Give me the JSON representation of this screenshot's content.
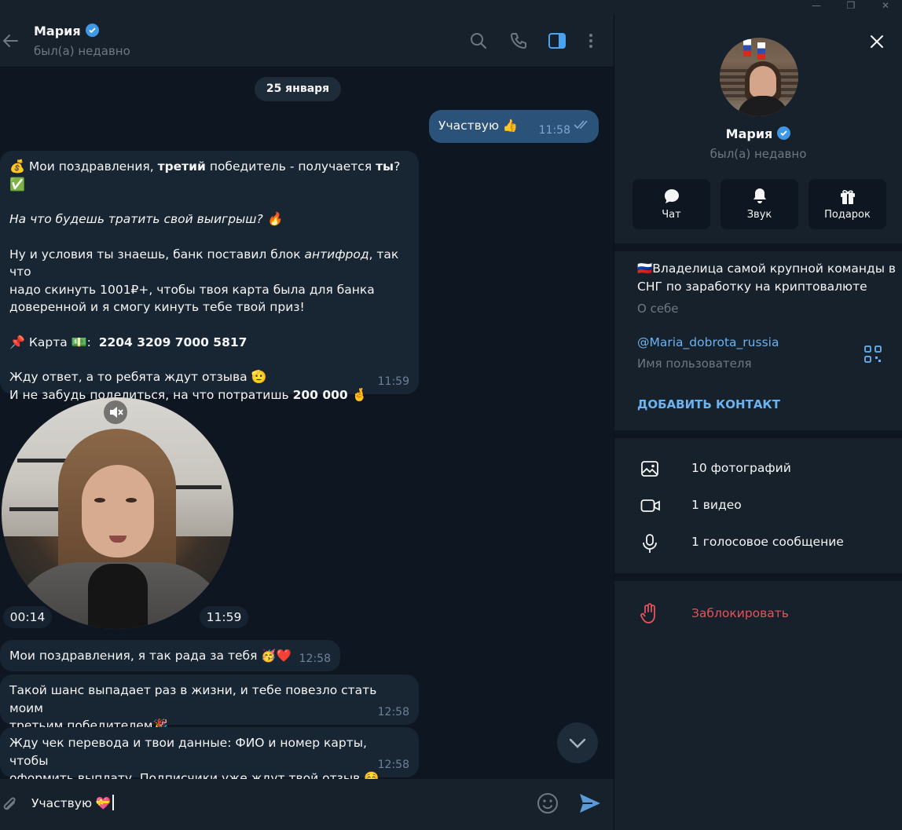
{
  "window": {
    "min": "—",
    "restore": "❐",
    "close": "✕"
  },
  "header": {
    "title": "Мария",
    "status": "был(а) недавно"
  },
  "date_separator": "25 января",
  "messages": {
    "out1": {
      "text": "Участвую 👍",
      "time": "11:58"
    },
    "in1": {
      "l1_emoji": "💰",
      "l1_a": "Мои поздравления, ",
      "l1_b": "третий",
      "l1_c": " победитель - получается ",
      "l1_d": "ты",
      "l1_e": "?",
      "l2_emoji": "✅",
      "l3": "На что будешь тратить свой выигрыш?",
      "l3_emoji": "🔥",
      "l4_a": "Ну и условия ты знаешь, банк поставил блок ",
      "l4_b": "антифрод",
      "l4_c": ", так что",
      "l5": "надо скинуть 1001₽+, чтобы твоя карта была для банка",
      "l6": "доверенной и я смогу кинуть тебе твой приз!",
      "l7_emoji": "📌",
      "l7_a": "Карта",
      "l7_emoji2": "💵",
      "l7_b": ":",
      "l7_card": "2204 3209 7000 5817",
      "l8": "Жду ответ, а то ребята ждут отзыва",
      "l8_emoji": "🫡",
      "l9_a": "И не забудь поделиться, на что потратишь ",
      "l9_b": "200 000",
      "l9_emoji": "🤞",
      "time": "11:59"
    },
    "video": {
      "duration": "00:14",
      "time": "11:59"
    },
    "in2": {
      "text": "Мои поздравления, я так рада за тебя 🥳❤️",
      "time": "12:58"
    },
    "in3": {
      "l1": "Такой шанс выпадает раз в жизни, и тебе повезло стать моим",
      "l2": "третьим победителем🎉",
      "time": "12:58"
    },
    "in4": {
      "l1": "Жду чек перевода и твои данные: ФИО и номер карты, чтобы",
      "l2": "оформить выплату. Подписчики уже ждут твой отзыв ☺️",
      "time": "12:58"
    }
  },
  "composer": {
    "text": "Участвую 💝"
  },
  "profile": {
    "name": "Мария",
    "status": "был(а) недавно",
    "actions": [
      {
        "label": "Чат"
      },
      {
        "label": "Звук"
      },
      {
        "label": "Подарок"
      }
    ],
    "bio_l1": "🇷🇺Владелица самой крупной команды в",
    "bio_l2": "СНГ по заработку на криптовалюте",
    "bio_label": "О себе",
    "username": "@Maria_dobrota_russia",
    "username_label": "Имя пользователя",
    "add_contact": "ДОБАВИТЬ КОНТАКТ",
    "media": [
      {
        "label": "10 фотографий",
        "icon": "photo-icon"
      },
      {
        "label": "1 видео",
        "icon": "video-icon"
      },
      {
        "label": "1 голосовое сообщение",
        "icon": "microphone-icon"
      }
    ],
    "block": "Заблокировать"
  },
  "colors": {
    "accent": "#6ab2f2",
    "outgoing_bubble": "#2b5278",
    "incoming_bubble": "#182533",
    "danger": "#e5535b"
  }
}
